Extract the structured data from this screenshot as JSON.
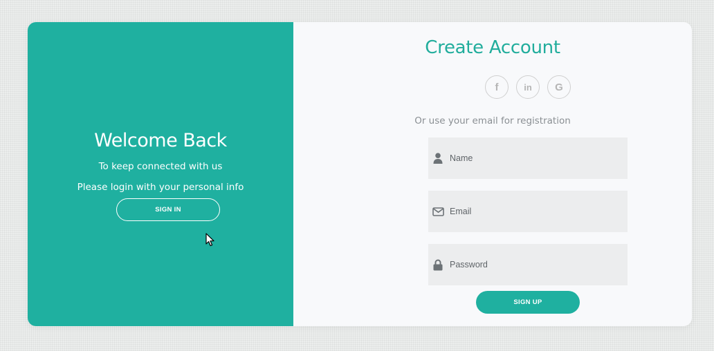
{
  "colors": {
    "accent": "#1fb0a0",
    "title_accent": "#21ad9c",
    "panel_background": "#f8f9fb",
    "field_background": "#ecedee"
  },
  "overlay": {
    "title": "Welcome Back",
    "line1": "To keep connected with us",
    "line2": "Please login with your personal info",
    "signin_label": "SIGN IN"
  },
  "form": {
    "title": "Create Account",
    "social": [
      {
        "icon": "facebook-icon",
        "glyph": "f"
      },
      {
        "icon": "linkedin-icon",
        "glyph": "in"
      },
      {
        "icon": "google-icon",
        "glyph": "G"
      }
    ],
    "note": "Or use your email for registration",
    "fields": {
      "name": {
        "icon": "user-icon",
        "placeholder": "Name",
        "value": ""
      },
      "email": {
        "icon": "envelope-icon",
        "placeholder": "Email",
        "value": ""
      },
      "password": {
        "icon": "lock-icon",
        "placeholder": "Password",
        "value": ""
      }
    },
    "signup_label": "SIGN UP"
  }
}
